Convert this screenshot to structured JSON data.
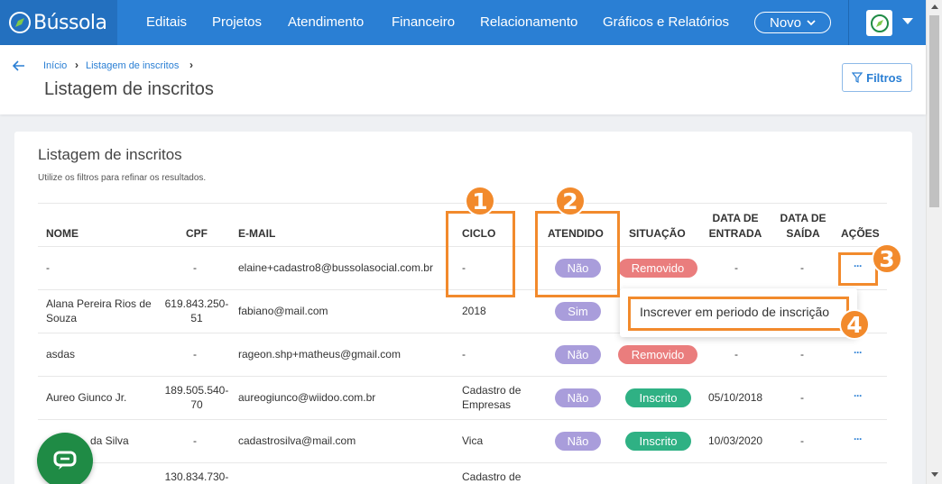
{
  "brand": {
    "name": "Bússola"
  },
  "nav": {
    "items": [
      "Editais",
      "Projetos",
      "Atendimento",
      "Financeiro",
      "Relacionamento",
      "Gráficos e Relatórios"
    ],
    "novo_label": "Novo"
  },
  "breadcrumb": {
    "home": "Início",
    "current": "Listagem de inscritos"
  },
  "page": {
    "title": "Listagem de inscritos",
    "filter_label": "Filtros"
  },
  "card": {
    "title": "Listagem de inscritos",
    "subtitle": "Utilize os filtros para refinar os resultados."
  },
  "table": {
    "headers": {
      "nome": "NOME",
      "cpf": "CPF",
      "email": "E-MAIL",
      "ciclo": "CICLO",
      "atendido": "ATENDIDO",
      "situacao": "SITUAÇÃO",
      "data_entrada": "DATA DE ENTRADA",
      "data_saida": "DATA DE SAÍDA",
      "acoes": "AÇÕES"
    },
    "rows": [
      {
        "nome": "-",
        "cpf": "-",
        "email": "elaine+cadastro8@bussolasocial.com.br",
        "ciclo": "-",
        "atendido": "Não",
        "situacao": "Removido",
        "entrada": "-",
        "saida": "-",
        "acoes": "···"
      },
      {
        "nome": "Alana Pereira Rios de Souza",
        "cpf": "619.843.250-51",
        "email": "fabiano@mail.com",
        "ciclo": "2018",
        "atendido": "Sim",
        "situacao": "",
        "entrada": "",
        "saida": "",
        "acoes": ""
      },
      {
        "nome": "asdas",
        "cpf": "-",
        "email": "rageon.shp+matheus@gmail.com",
        "ciclo": "-",
        "atendido": "Não",
        "situacao": "Removido",
        "entrada": "-",
        "saida": "-",
        "acoes": "···"
      },
      {
        "nome": "Aureo Giunco Jr.",
        "cpf": "189.505.540-70",
        "email": "aureogiunco@wiidoo.com.br",
        "ciclo": "Cadastro de Empresas",
        "atendido": "Não",
        "situacao": "Inscrito",
        "entrada": "05/10/2018",
        "saida": "-",
        "acoes": "···"
      },
      {
        "nome": "da Silva",
        "cpf": "-",
        "email": "cadastrosilva@mail.com",
        "ciclo": "Vica",
        "atendido": "Não",
        "situacao": "Inscrito",
        "entrada": "10/03/2020",
        "saida": "-",
        "acoes": "···"
      },
      {
        "nome": "",
        "cpf": "130.834.730-",
        "email": "",
        "ciclo": "Cadastro de",
        "atendido": "",
        "situacao": "",
        "entrada": "",
        "saida": "",
        "acoes": ""
      }
    ]
  },
  "menu": {
    "item": "Inscrever em periodo de inscrição"
  },
  "annotations": [
    "1",
    "2",
    "3",
    "4"
  ],
  "icons": {
    "back": "arrow-left-icon",
    "filter": "funnel-icon",
    "chat": "chat-icon",
    "logo": "compass-icon"
  },
  "colors": {
    "nav": "#2a7fd4",
    "annotation": "#f28a2c",
    "pill_nao": "#a99ddb",
    "pill_removido": "#ea7d7d",
    "pill_inscrito": "#2fb184",
    "chat": "#1f8b45"
  }
}
